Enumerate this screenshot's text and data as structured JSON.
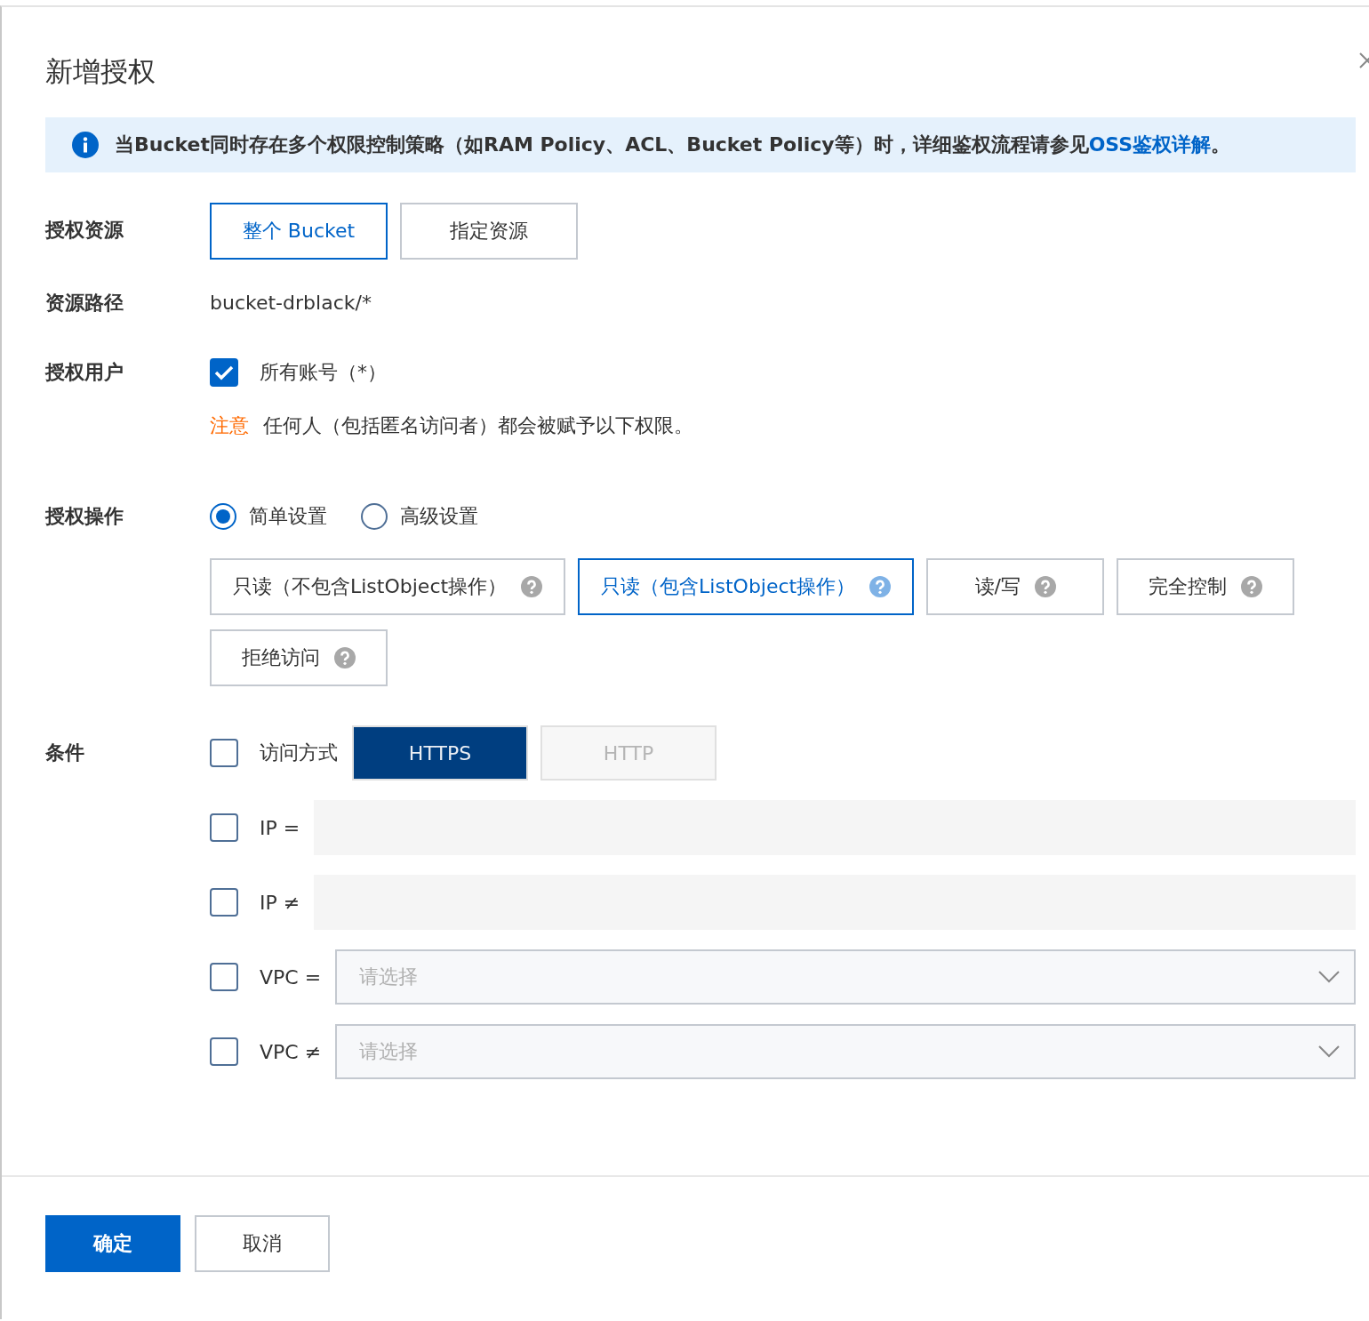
{
  "dialog": {
    "title": "新增授权"
  },
  "notice": {
    "text": "当Bucket同时存在多个权限控制策略（如RAM Policy、ACL、Bucket Policy等）时，详细鉴权流程请参见",
    "link": "OSS鉴权详解",
    "end": "。"
  },
  "resource": {
    "label": "授权资源",
    "options": [
      {
        "label": "整个 Bucket",
        "selected": true
      },
      {
        "label": "指定资源",
        "selected": false
      }
    ]
  },
  "path": {
    "label": "资源路径",
    "value": "bucket-drblack/*"
  },
  "user": {
    "label": "授权用户",
    "checkbox": {
      "label": "所有账号（*）",
      "checked": true
    },
    "warning": {
      "tag": "注意",
      "text": "任何人（包括匿名访问者）都会被赋予以下权限。"
    }
  },
  "operation": {
    "label": "授权操作",
    "modes": [
      {
        "label": "简单设置",
        "selected": true
      },
      {
        "label": "高级设置",
        "selected": false
      }
    ],
    "permissions": [
      {
        "label": "只读（不包含ListObject操作）",
        "selected": false
      },
      {
        "label": "只读（包含ListObject操作）",
        "selected": true
      },
      {
        "label": "读/写",
        "selected": false
      },
      {
        "label": "完全控制",
        "selected": false
      },
      {
        "label": "拒绝访问",
        "selected": false
      }
    ]
  },
  "conditions": {
    "label": "条件",
    "rows": [
      {
        "kind": "protocol",
        "label": "访问方式",
        "checked": false,
        "options": [
          {
            "label": "HTTPS",
            "selected": true
          },
          {
            "label": "HTTP",
            "selected": false
          }
        ]
      },
      {
        "kind": "input",
        "label": "IP =",
        "checked": false
      },
      {
        "kind": "input",
        "label": "IP ≠",
        "checked": false
      },
      {
        "kind": "select",
        "label": "VPC =",
        "checked": false,
        "placeholder": "请选择"
      },
      {
        "kind": "select",
        "label": "VPC ≠",
        "checked": false,
        "placeholder": "请选择"
      }
    ]
  },
  "footer": {
    "buttons": [
      {
        "label": "确定",
        "kind": "primary"
      },
      {
        "label": "取消",
        "kind": "default"
      }
    ]
  }
}
